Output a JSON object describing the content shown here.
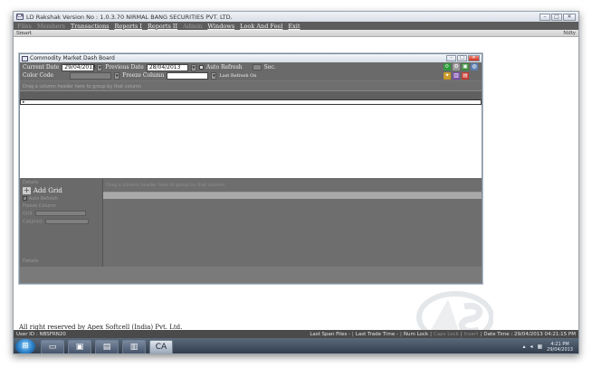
{
  "app": {
    "title": "LD Rakshak Version No : 1.0.3.70 NIRMAL BANG SECURITIES PVT. LTD.",
    "logo": "CA"
  },
  "window_buttons": {
    "minimize": "–",
    "maximize": "□",
    "close": "✕"
  },
  "menu": [
    {
      "label": "Files",
      "enabled": false
    },
    {
      "label": "Members",
      "enabled": false
    },
    {
      "label": "Transactions",
      "enabled": true
    },
    {
      "label": "Reports I",
      "enabled": true
    },
    {
      "label": "Reports II",
      "enabled": true
    },
    {
      "label": "Admin",
      "enabled": false
    },
    {
      "label": "Windows",
      "enabled": true
    },
    {
      "label": "Look And Feel",
      "enabled": true
    },
    {
      "label": "Exit",
      "enabled": true
    }
  ],
  "smart_bar": {
    "left": "Smart",
    "right": "Nifty"
  },
  "dashboard": {
    "title": "Commodity Market Dash Board",
    "current_date_label": "Current Date",
    "current_date_value": "29/04/2013",
    "previous_date_label": "Previous Date",
    "previous_date_value": "28/04/2013",
    "auto_refresh_label": "Auto Refresh",
    "sec_label": "Sec.",
    "color_code_label": "Color Code",
    "freeze_column_label": "Freeze Column",
    "last_refresh_label": "Last Refresh On",
    "group_hint": "Drag a column header here to group by that column",
    "lower": {
      "details_label": "Details",
      "add_grid_label": "Add Grid",
      "auto_refresh_label": "Auto Refresh",
      "freeze_column_label": "Freeze Column",
      "grid_label": "Grid",
      "columns_label": "Columns",
      "details_bottom": "Details",
      "group_hint": "Drag a column header here to group by that column"
    }
  },
  "footer_text": "All right reserved by Apex Softcell (India) Pvt. Ltd.",
  "status": {
    "user": "User ID : NBSFRN20",
    "last_span": "Last Span Files -",
    "last_trade": "Last Trade Time -",
    "num_lock": "Num Lock",
    "caps_lock": "Caps Lock",
    "insert": "Insert",
    "datetime": "Date Time : 29/04/2013 04:21:15 PM"
  },
  "taskbar": {
    "clock_time": "4:21 PM",
    "clock_date": "29/04/2013"
  },
  "colors": {
    "menubar": "#5c5c5c",
    "panel": "#6a6a6a",
    "statusbar": "#4a4a4a",
    "taskbar": "#2d3846"
  }
}
